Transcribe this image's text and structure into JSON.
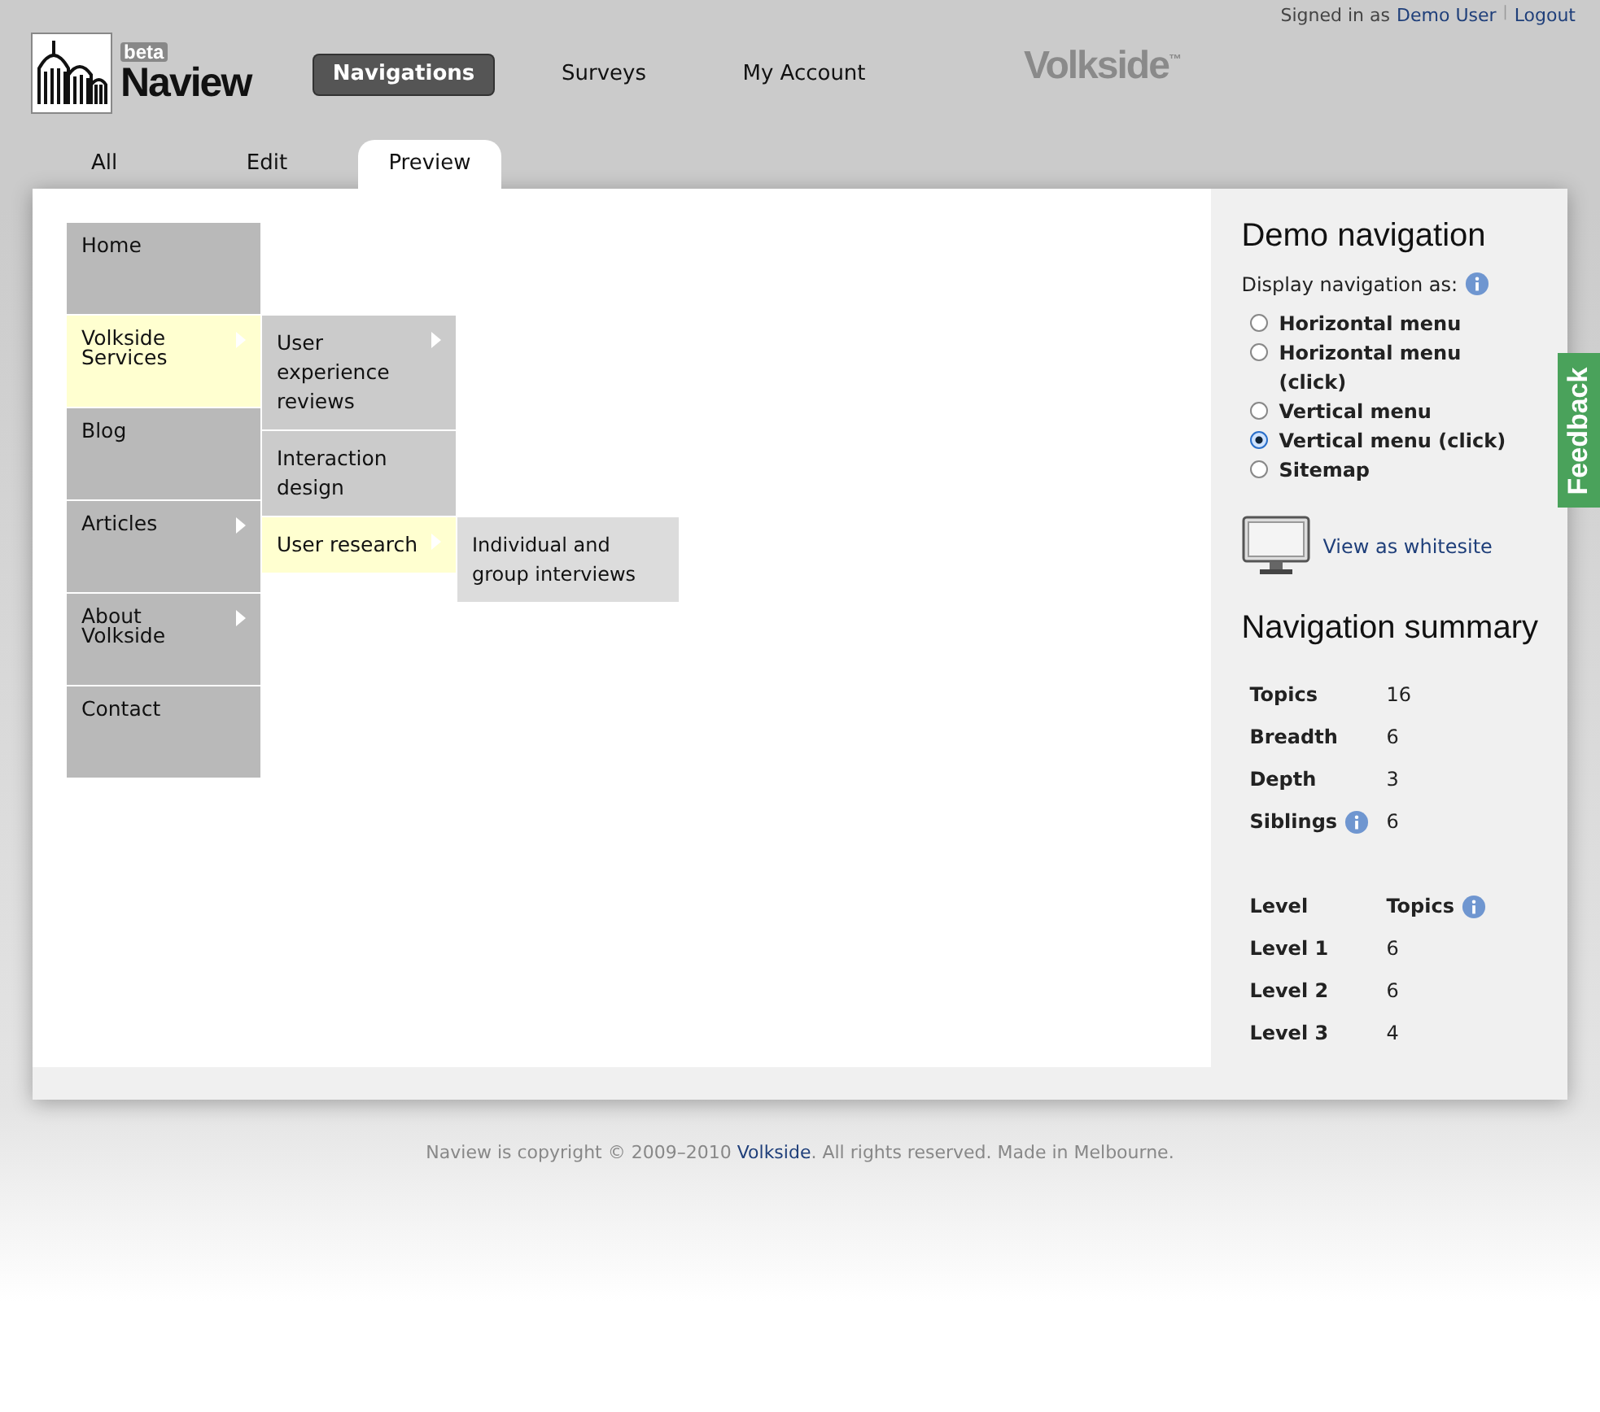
{
  "user_bar": {
    "prefix": "Signed in as",
    "user": "Demo User",
    "separator": "|",
    "logout": "Logout"
  },
  "brand": {
    "badge": "beta",
    "name": "Naview"
  },
  "main_nav": [
    {
      "label": "Navigations",
      "selected": true
    },
    {
      "label": "Surveys",
      "selected": false
    },
    {
      "label": "My Account",
      "selected": false
    }
  ],
  "partner_logo": "Volkside$^{™}$",
  "tabs": [
    {
      "label": "All",
      "selected": false
    },
    {
      "label": "Edit",
      "selected": false
    },
    {
      "label": "Preview",
      "selected": true
    }
  ],
  "menu": [
    {
      "label": "Home",
      "has_submenu": false,
      "selected": false
    },
    {
      "label": "Volkside Services",
      "has_submenu": true,
      "selected": true,
      "children": [
        {
          "label": "User experience reviews",
          "has_submenu": true,
          "selected": false
        },
        {
          "label": "Interaction design",
          "has_submenu": false,
          "selected": false
        },
        {
          "label": "User research",
          "has_submenu": true,
          "selected": true,
          "children": [
            {
              "label": "Individual and group interviews",
              "has_submenu": false,
              "selected": false
            }
          ]
        }
      ]
    },
    {
      "label": "Blog",
      "has_submenu": false,
      "selected": false
    },
    {
      "label": "Articles",
      "has_submenu": true,
      "selected": false
    },
    {
      "label": "About Volkside",
      "has_submenu": true,
      "selected": false
    },
    {
      "label": "Contact",
      "has_submenu": false,
      "selected": false
    }
  ],
  "sidebar": {
    "title": "Demo navigation",
    "display_label": "Display navigation as:",
    "options": [
      {
        "label": "Horizontal menu",
        "selected": false
      },
      {
        "label": "Horizontal menu (click)",
        "selected": false
      },
      {
        "label": "Vertical menu",
        "selected": false
      },
      {
        "label": "Vertical menu (click)",
        "selected": true
      },
      {
        "label": "Sitemap",
        "selected": false
      }
    ],
    "whitesite_link": "View as whitesite",
    "summary_title": "Navigation summary",
    "summary": [
      {
        "label": "Topics",
        "value": "16",
        "info": false
      },
      {
        "label": "Breadth",
        "value": "6",
        "info": false
      },
      {
        "label": "Depth",
        "value": "3",
        "info": false
      },
      {
        "label": "Siblings",
        "value": "6",
        "info": true
      }
    ],
    "levels_header": {
      "label": "Level",
      "value": "Topics",
      "info": true
    },
    "levels": [
      {
        "label": "Level 1",
        "value": "6"
      },
      {
        "label": "Level 2",
        "value": "6"
      },
      {
        "label": "Level 3",
        "value": "4"
      }
    ]
  },
  "feedback_tab": "Feedback",
  "footer": {
    "before": "Naview is copyright © 2009–2010",
    "link": "Volkside",
    "after": ". All rights reserved. Made in Melbourne."
  }
}
